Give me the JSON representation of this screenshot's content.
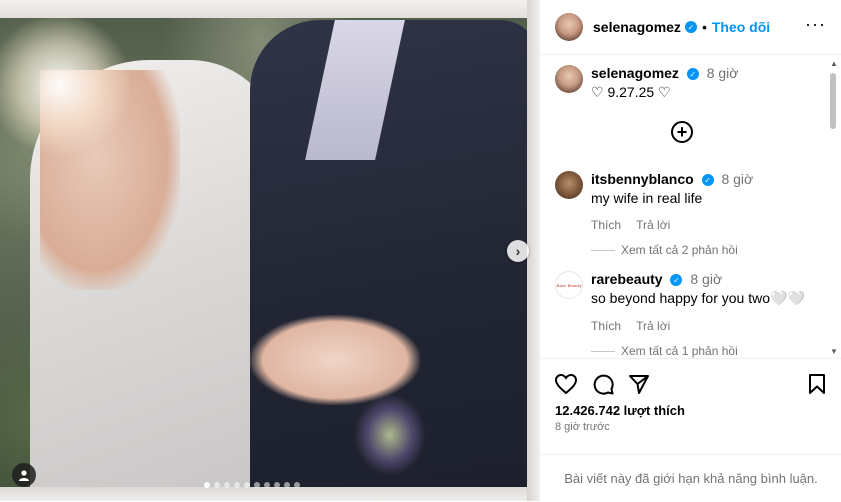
{
  "post": {
    "image_alt": "",
    "carousel": {
      "dot_count": 10,
      "active_index": 0
    }
  },
  "header": {
    "username": "selenagomez",
    "follow_label": "Theo dõi",
    "separator": "•",
    "more_icon": "more-horizontal-icon"
  },
  "caption": {
    "username": "selenagomez",
    "time": "8 giờ",
    "text": "9.27.25"
  },
  "comments": [
    {
      "username": "itsbennyblanco",
      "time": "8 giờ",
      "text": "my wife in real life",
      "like_label": "Thích",
      "reply_label": "Trả lời",
      "view_replies": "Xem tất cả 2 phản hồi"
    },
    {
      "username": "rarebeauty",
      "time": "8 giờ",
      "text": "so beyond happy for you two🤍🤍",
      "like_label": "Thích",
      "reply_label": "Trả lời",
      "view_replies": "Xem tất cả 1 phản hồi",
      "avatar_text": "Rare Beauty"
    }
  ],
  "stats": {
    "likes": "12.426.742 lượt thích",
    "time_ago": "8 giờ trước"
  },
  "footer": {
    "limited_text": "Bài viết này đã giới hạn khả năng bình luận."
  },
  "colors": {
    "accent": "#0095f6",
    "muted": "#737373"
  }
}
